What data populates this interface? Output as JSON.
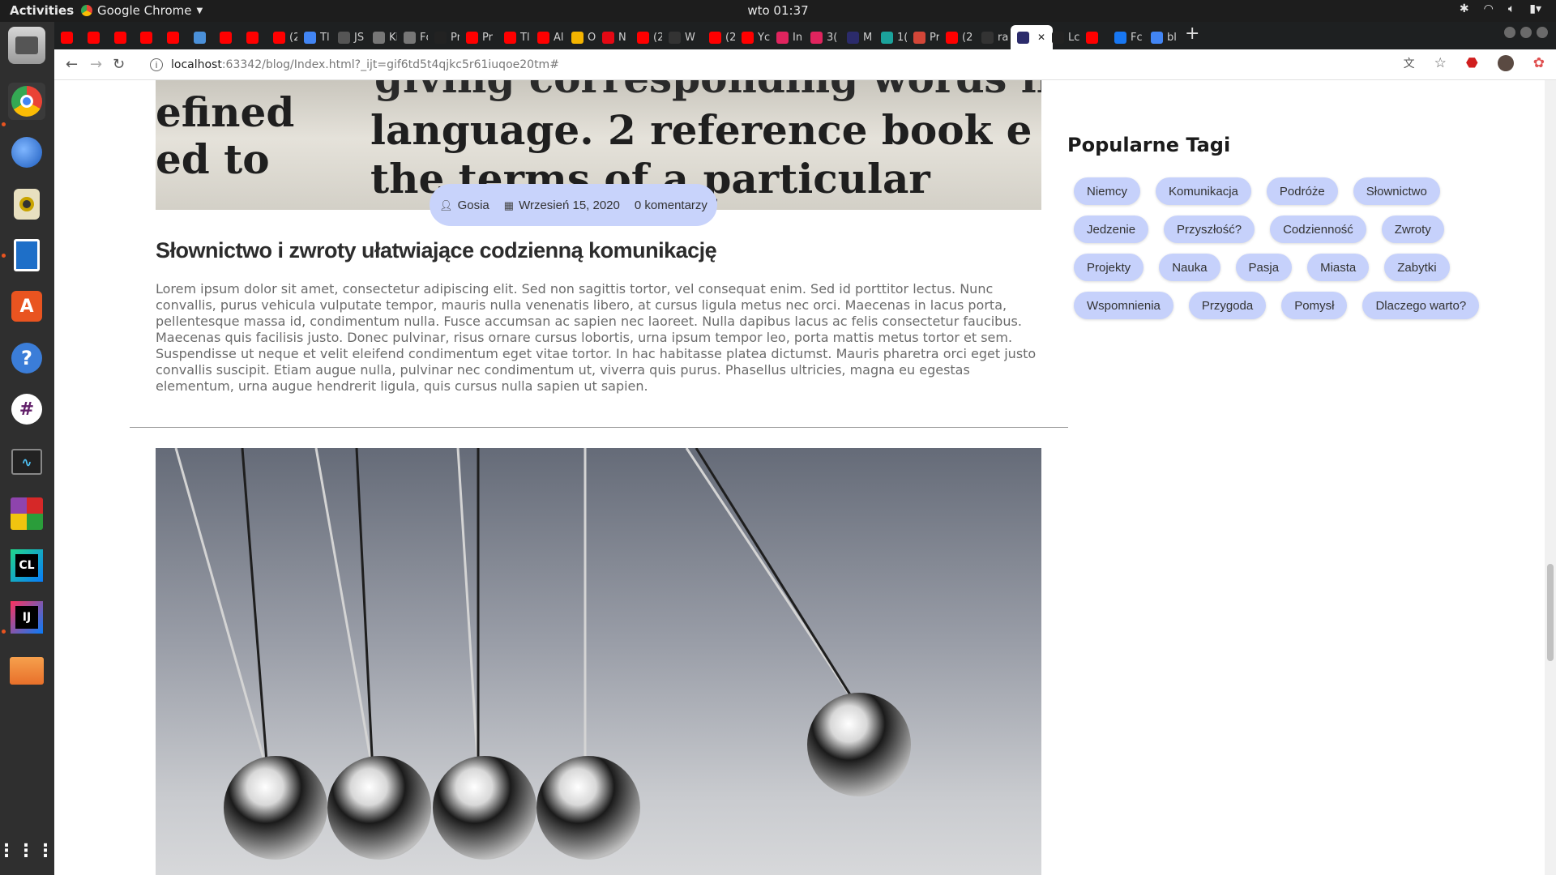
{
  "topbar": {
    "activities": "Activities",
    "app_name": "Google Chrome",
    "clock": "wto 01:37"
  },
  "tabs": [
    {
      "label": "",
      "color": "#ff0000",
      "icon": "youtube-icon"
    },
    {
      "label": "",
      "color": "#ff0000",
      "icon": "youtube-icon"
    },
    {
      "label": "",
      "color": "#ff0000",
      "icon": "youtube-icon"
    },
    {
      "label": "",
      "color": "#ff0000",
      "icon": "youtube-icon"
    },
    {
      "label": "",
      "color": "#ff0000",
      "icon": "youtube-icon"
    },
    {
      "label": "",
      "color": "#4a90d9",
      "icon": "sync-icon"
    },
    {
      "label": "",
      "color": "#ff0000",
      "icon": "youtube-icon"
    },
    {
      "label": "",
      "color": "#ff0000",
      "icon": "youtube-icon"
    },
    {
      "label": "(2",
      "color": "#ff0000",
      "icon": "youtube-icon"
    },
    {
      "label": "Tl",
      "color": "#4285f4",
      "icon": "translate-icon"
    },
    {
      "label": "JS",
      "color": "#555555",
      "icon": "github-icon"
    },
    {
      "label": "Ki",
      "color": "#777777",
      "icon": "car-icon"
    },
    {
      "label": "Fc",
      "color": "#777777",
      "icon": "car-icon"
    },
    {
      "label": "Pr",
      "color": "#222222",
      "icon": "mask-icon"
    },
    {
      "label": "Pr",
      "color": "#ff0000",
      "icon": "youtube-icon"
    },
    {
      "label": "Tl",
      "color": "#ff0000",
      "icon": "youtube-icon"
    },
    {
      "label": "Al",
      "color": "#ff0000",
      "icon": "youtube-icon"
    },
    {
      "label": "O",
      "color": "#f4b400",
      "icon": "photos-icon"
    },
    {
      "label": "N",
      "color": "#e50914",
      "icon": "netflix-icon"
    },
    {
      "label": "(2",
      "color": "#ff0000",
      "icon": "youtube-icon"
    },
    {
      "label": "W",
      "color": "#333333",
      "icon": "page-icon"
    },
    {
      "label": "(2",
      "color": "#ff0000",
      "icon": "youtube-icon"
    },
    {
      "label": "Yc",
      "color": "#ff0000",
      "icon": "youtube-icon"
    },
    {
      "label": "In",
      "color": "#e0245e",
      "icon": "heart-icon"
    },
    {
      "label": "3(",
      "color": "#e0245e",
      "icon": "heart-icon"
    },
    {
      "label": "M",
      "color": "#2b2b6b",
      "icon": "intellij-icon"
    },
    {
      "label": "1(",
      "color": "#1ba39c",
      "icon": "d-icon"
    },
    {
      "label": "Pr",
      "color": "#d44638",
      "icon": "gmail-icon"
    },
    {
      "label": "(2",
      "color": "#ff0000",
      "icon": "youtube-icon"
    },
    {
      "label": "ra",
      "color": "#333333",
      "icon": "github-icon"
    },
    {
      "label": "",
      "color": "#2b2b6b",
      "icon": "intellij-icon",
      "active": true
    },
    {
      "label": "Lc",
      "color": "#222222",
      "icon": "text-cursor-icon"
    },
    {
      "label": "",
      "color": "#ff0000",
      "icon": "youtube-icon"
    },
    {
      "label": "Fc",
      "color": "#1877f2",
      "icon": "facebook-icon"
    },
    {
      "label": "bl",
      "color": "#4285f4",
      "icon": "google-icon"
    }
  ],
  "toolbar": {
    "url_host": "localhost",
    "url_rest": ":63342/blog/Index.html?_ijt=gif6td5t4qjkc5r61iuqoe20tm#"
  },
  "post": {
    "author": "Gosia",
    "date": "Wrzesień 15, 2020",
    "comments": "0 komentarzy",
    "title": "Słownictwo i zwroty ułatwiające codzienną komunikację",
    "body": "Lorem ipsum dolor sit amet, consectetur adipiscing elit. Sed non sagittis tortor, vel consequat enim. Sed id porttitor lectus. Nunc convallis, purus vehicula vulputate tempor, mauris nulla venenatis libero, at cursus ligula metus nec orci. Maecenas in lacus porta, pellentesque massa id, condimentum nulla. Fusce accumsan ac sapien nec laoreet. Nulla dapibus lacus ac felis consectetur faucibus. Maecenas quis facilisis justo. Donec pulvinar, risus ornare cursus lobortis, urna ipsum tempor leo, porta mattis metus tortor et sem. Suspendisse ut neque et velit eleifend condimentum eget vitae tortor. In hac habitasse platea dictumst. Mauris pharetra orci eget justo convallis suscipit. Etiam augue nulla, pulvinar nec condimentum ut, viverra quis purus. Phasellus ultricies, magna eu egestas elementum, urna augue hendrerit ligula, quis cursus nulla sapien ut sapien.",
    "hero_text": {
      "line1a": "giving corresponding words in",
      "line2a": "efined",
      "line2b": "language. 2 reference book e",
      "line3a": "ed to",
      "line3b": "the terms of a particular"
    }
  },
  "sidebar": {
    "title": "Popularne Tagi",
    "tags": [
      "Niemcy",
      "Komunikacja",
      "Podróże",
      "Słownictwo",
      "Jedzenie",
      "Przyszłość?",
      "Codzienność",
      "Zwroty",
      "Projekty",
      "Nauka",
      "Pasja",
      "Miasta",
      "Zabytki",
      "Wspomnienia",
      "Przygoda",
      "Pomysł",
      "Dlaczego warto?"
    ]
  },
  "colors": {
    "tag_bg": "#c6d1fb",
    "meta_bg": "#c8d3fb",
    "accent_ubuntu": "#e95420"
  }
}
